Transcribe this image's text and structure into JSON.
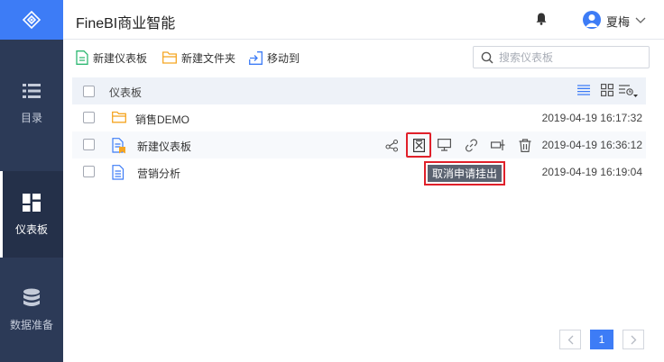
{
  "app": {
    "title": "FineBI商业智能"
  },
  "user": {
    "name": "夏梅"
  },
  "sidebar": {
    "items": [
      {
        "label": "目录",
        "icon": "list-icon"
      },
      {
        "label": "仪表板",
        "icon": "dashboard-icon",
        "active": true
      },
      {
        "label": "数据准备",
        "icon": "database-icon"
      }
    ]
  },
  "toolbar": {
    "new_dashboard": "新建仪表板",
    "new_folder": "新建文件夹",
    "move_to": "移动到"
  },
  "search": {
    "placeholder": "搜索仪表板",
    "value": ""
  },
  "table": {
    "header": "仪表板",
    "rows": [
      {
        "name": "销售DEMO",
        "type": "folder",
        "time": "2019-04-19 16:17:32"
      },
      {
        "name": "新建仪表板",
        "type": "dashboard-pending",
        "time": "2019-04-19 16:36:12"
      },
      {
        "name": "营销分析",
        "type": "dashboard",
        "time": "2019-04-19 16:19:04"
      }
    ]
  },
  "tooltip": {
    "text": "取消申请挂出"
  },
  "pagination": {
    "current": "1"
  },
  "colors": {
    "accent": "#3d7cf6",
    "sidebar": "#2c3a57",
    "highlight": "#e0202a",
    "folder": "#f5a623",
    "new_dash": "#2eb872"
  }
}
